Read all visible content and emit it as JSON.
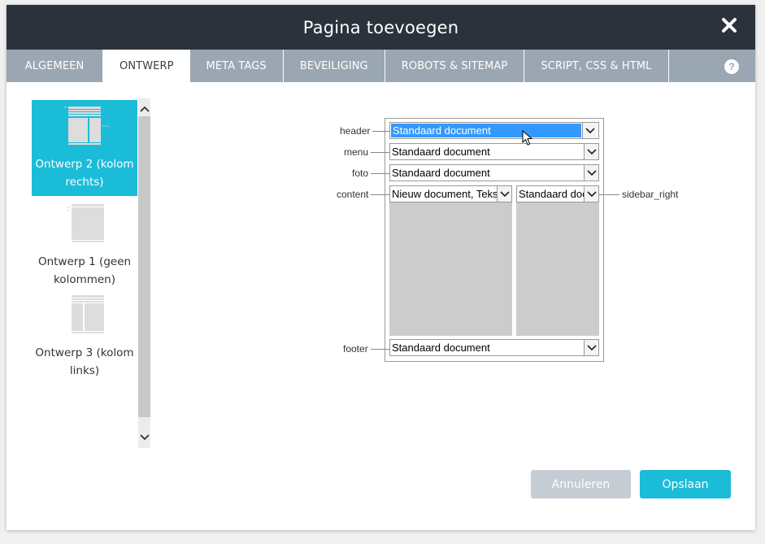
{
  "dialog": {
    "title": "Pagina toevoegen"
  },
  "tabs": [
    {
      "label": "ALGEMEEN",
      "active": false
    },
    {
      "label": "ONTWERP",
      "active": true
    },
    {
      "label": "META TAGS",
      "active": false
    },
    {
      "label": "BEVEILIGING",
      "active": false
    },
    {
      "label": "ROBOTS & SITEMAP",
      "active": false
    },
    {
      "label": "SCRIPT, CSS & HTML",
      "active": false
    }
  ],
  "help_label": "?",
  "designs": [
    {
      "line1": "Ontwerp 2 (kolom",
      "line2": "rechts)",
      "selected": true
    },
    {
      "line1": "Ontwerp 1 (geen",
      "line2": "kolommen)",
      "selected": false
    },
    {
      "line1": "Ontwerp 3 (kolom",
      "line2": "links)",
      "selected": false
    }
  ],
  "regions": {
    "header": {
      "label": "header",
      "value": "Standaard document"
    },
    "menu": {
      "label": "menu",
      "value": "Standaard document"
    },
    "foto": {
      "label": "foto",
      "value": "Standaard document"
    },
    "content": {
      "label": "content",
      "value": "Nieuw document, Tekst"
    },
    "sidebar": {
      "label": "sidebar_right",
      "value": "Standaard document"
    },
    "footer": {
      "label": "footer",
      "value": "Standaard document"
    }
  },
  "buttons": {
    "cancel": "Annuleren",
    "save": "Opslaan"
  },
  "colors": {
    "accent": "#1bbcd8",
    "titlebar": "#2b323b",
    "tabbar": "#9aa6b2",
    "cancel": "#c5ccd3",
    "highlight": "#3399ff"
  }
}
